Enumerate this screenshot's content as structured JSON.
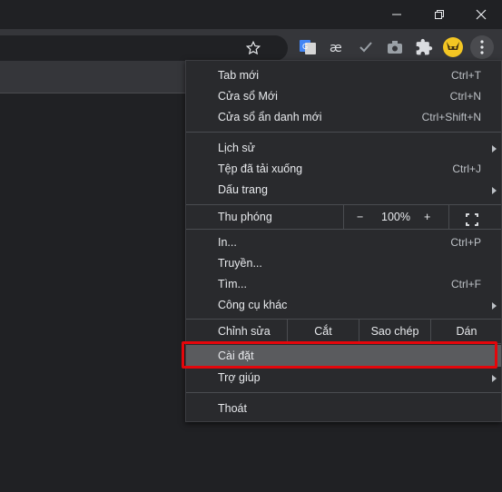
{
  "menu": {
    "new_tab": {
      "label": "Tab mới",
      "shortcut": "Ctrl+T"
    },
    "new_window": {
      "label": "Cửa sổ Mới",
      "shortcut": "Ctrl+N"
    },
    "incognito": {
      "label": "Cửa sổ ẩn danh mới",
      "shortcut": "Ctrl+Shift+N"
    },
    "history": {
      "label": "Lịch sử"
    },
    "downloads": {
      "label": "Tệp đã tải xuống",
      "shortcut": "Ctrl+J"
    },
    "bookmarks": {
      "label": "Dấu trang"
    },
    "zoom": {
      "label": "Thu phóng",
      "minus": "−",
      "value": "100%",
      "plus": "+"
    },
    "print": {
      "label": "In...",
      "shortcut": "Ctrl+P"
    },
    "cast": {
      "label": "Truyền..."
    },
    "find": {
      "label": "Tìm...",
      "shortcut": "Ctrl+F"
    },
    "more_tools": {
      "label": "Công cụ khác"
    },
    "edit": {
      "label": "Chỉnh sửa",
      "cut": "Cắt",
      "copy": "Sao chép",
      "paste": "Dán"
    },
    "settings": {
      "label": "Cài đặt"
    },
    "help": {
      "label": "Trợ giúp"
    },
    "exit": {
      "label": "Thoát"
    }
  },
  "icons": {
    "star": "star-icon",
    "translate": "google-translate-icon",
    "ae": "ae-extension-icon",
    "check": "checkmark-icon",
    "camera": "camera-icon",
    "puzzle": "extensions-puzzle-icon",
    "avatar": "profile-avatar-icon",
    "kebab": "three-dots-menu-icon"
  },
  "colors": {
    "highlight_border": "#e4060b",
    "menu_bg": "#292a2d",
    "hover_bg": "#5a5b5e"
  }
}
